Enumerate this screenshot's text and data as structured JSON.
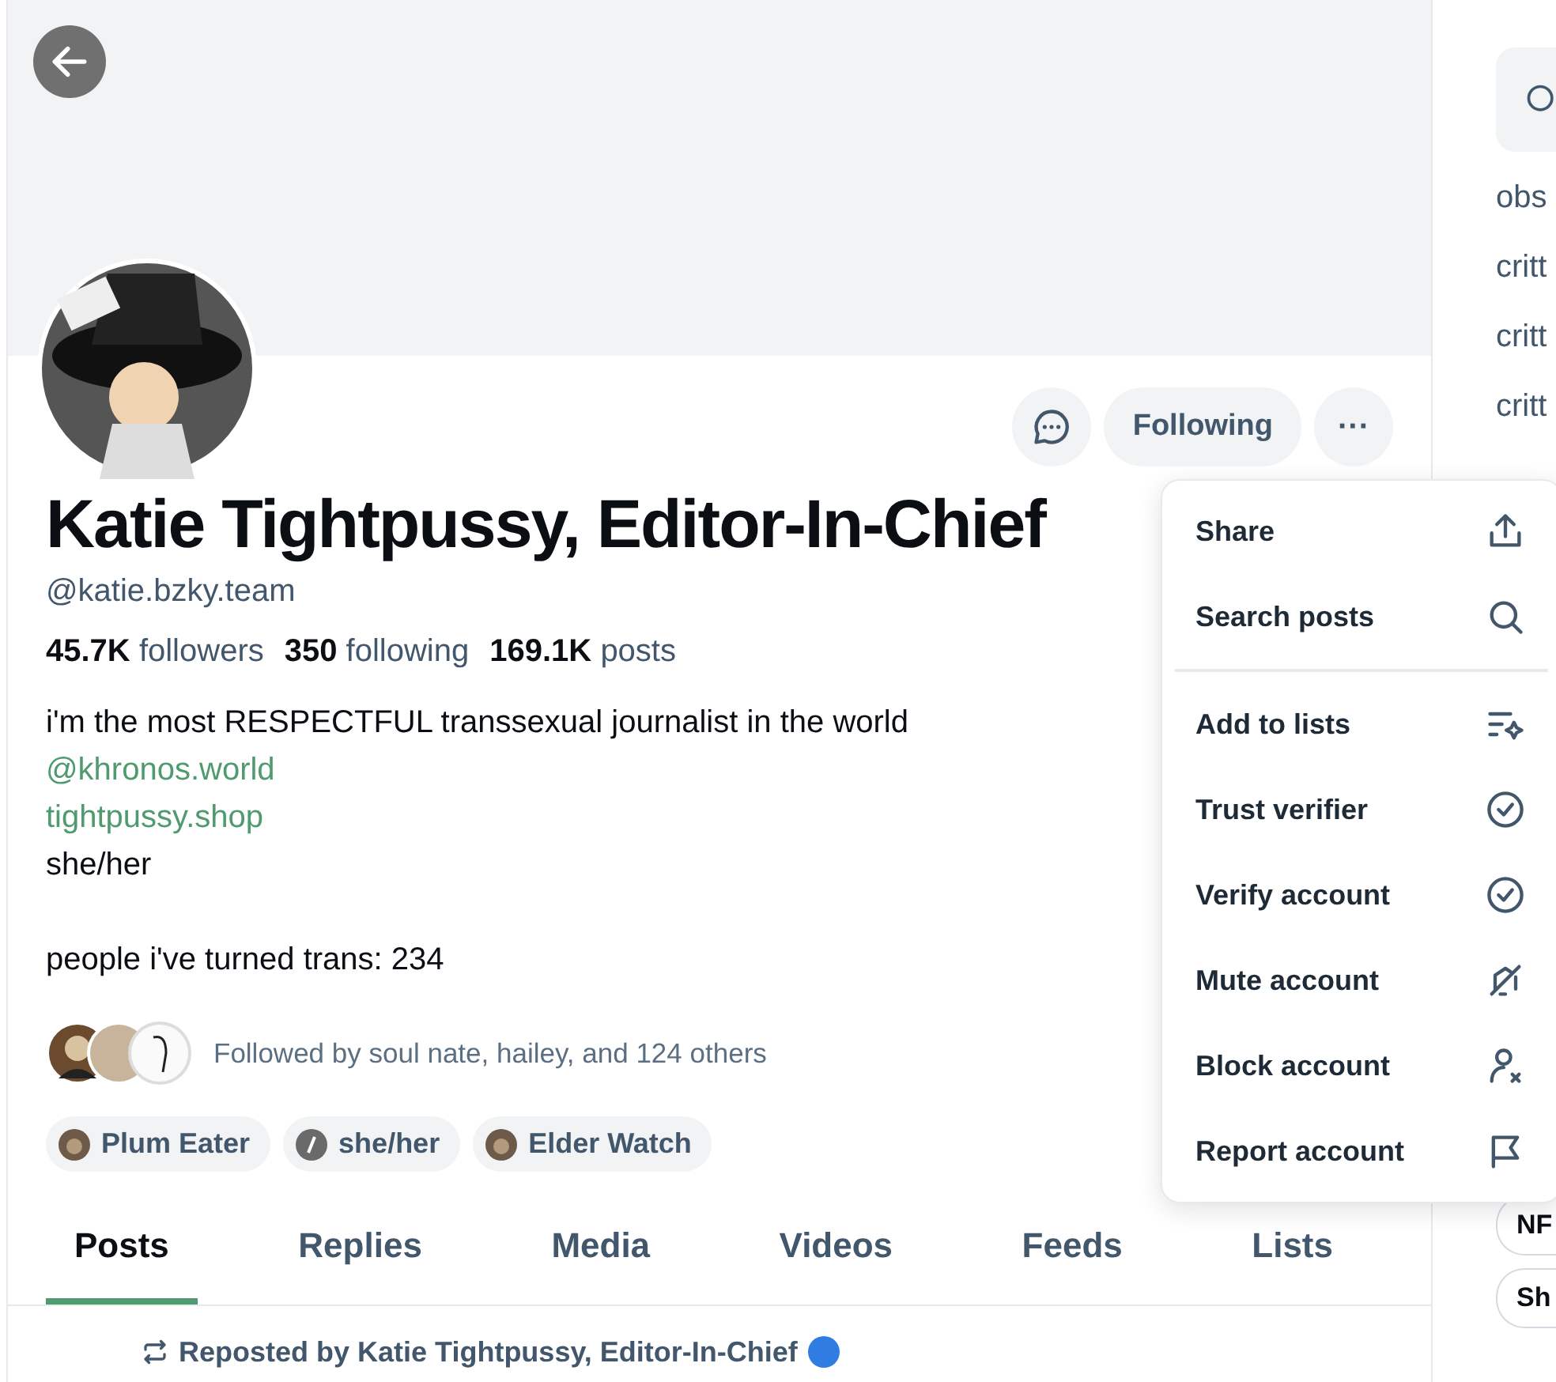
{
  "profile": {
    "name": "Katie Tightpussy, Editor-In-Chief",
    "handle": "@katie.bzky.team",
    "stats": [
      {
        "count": "45.7K",
        "label": "followers"
      },
      {
        "count": "350",
        "label": "following"
      },
      {
        "count": "169.1K",
        "label": "posts"
      }
    ],
    "bio": [
      {
        "kind": "text",
        "text": "i'm the most RESPECTFUL transsexual journalist in the world"
      },
      {
        "kind": "link",
        "text": "@khronos.world"
      },
      {
        "kind": "link",
        "text": "tightpussy.shop"
      },
      {
        "kind": "text",
        "text": "she/her"
      },
      {
        "kind": "blank"
      },
      {
        "kind": "text",
        "text": "people i've turned trans: 234"
      }
    ],
    "followed_by": "Followed by soul nate, hailey, and 124 others",
    "labels": [
      {
        "text": "Plum Eater",
        "kind": "avatar"
      },
      {
        "text": "she/her",
        "kind": "slash"
      },
      {
        "text": "Elder Watch",
        "kind": "avatar"
      }
    ],
    "actions": {
      "follow_button": "Following",
      "more_button": "···"
    }
  },
  "tabs": [
    {
      "label": "Posts",
      "selected": true
    },
    {
      "label": "Replies",
      "selected": false
    },
    {
      "label": "Media",
      "selected": false
    },
    {
      "label": "Videos",
      "selected": false
    },
    {
      "label": "Feeds",
      "selected": false
    },
    {
      "label": "Lists",
      "selected": false
    }
  ],
  "repost": {
    "text": "Reposted by Katie Tightpussy, Editor-In-Chief"
  },
  "menu": {
    "groups": [
      [
        "Share",
        "Search posts"
      ],
      [
        "Add to lists",
        "Trust verifier",
        "Verify account",
        "Mute account",
        "Block account",
        "Report account"
      ]
    ]
  },
  "sidebar": {
    "trending": [
      "obs",
      "critt",
      "critt",
      "critt"
    ],
    "pills": [
      "NF",
      "Sh"
    ]
  }
}
